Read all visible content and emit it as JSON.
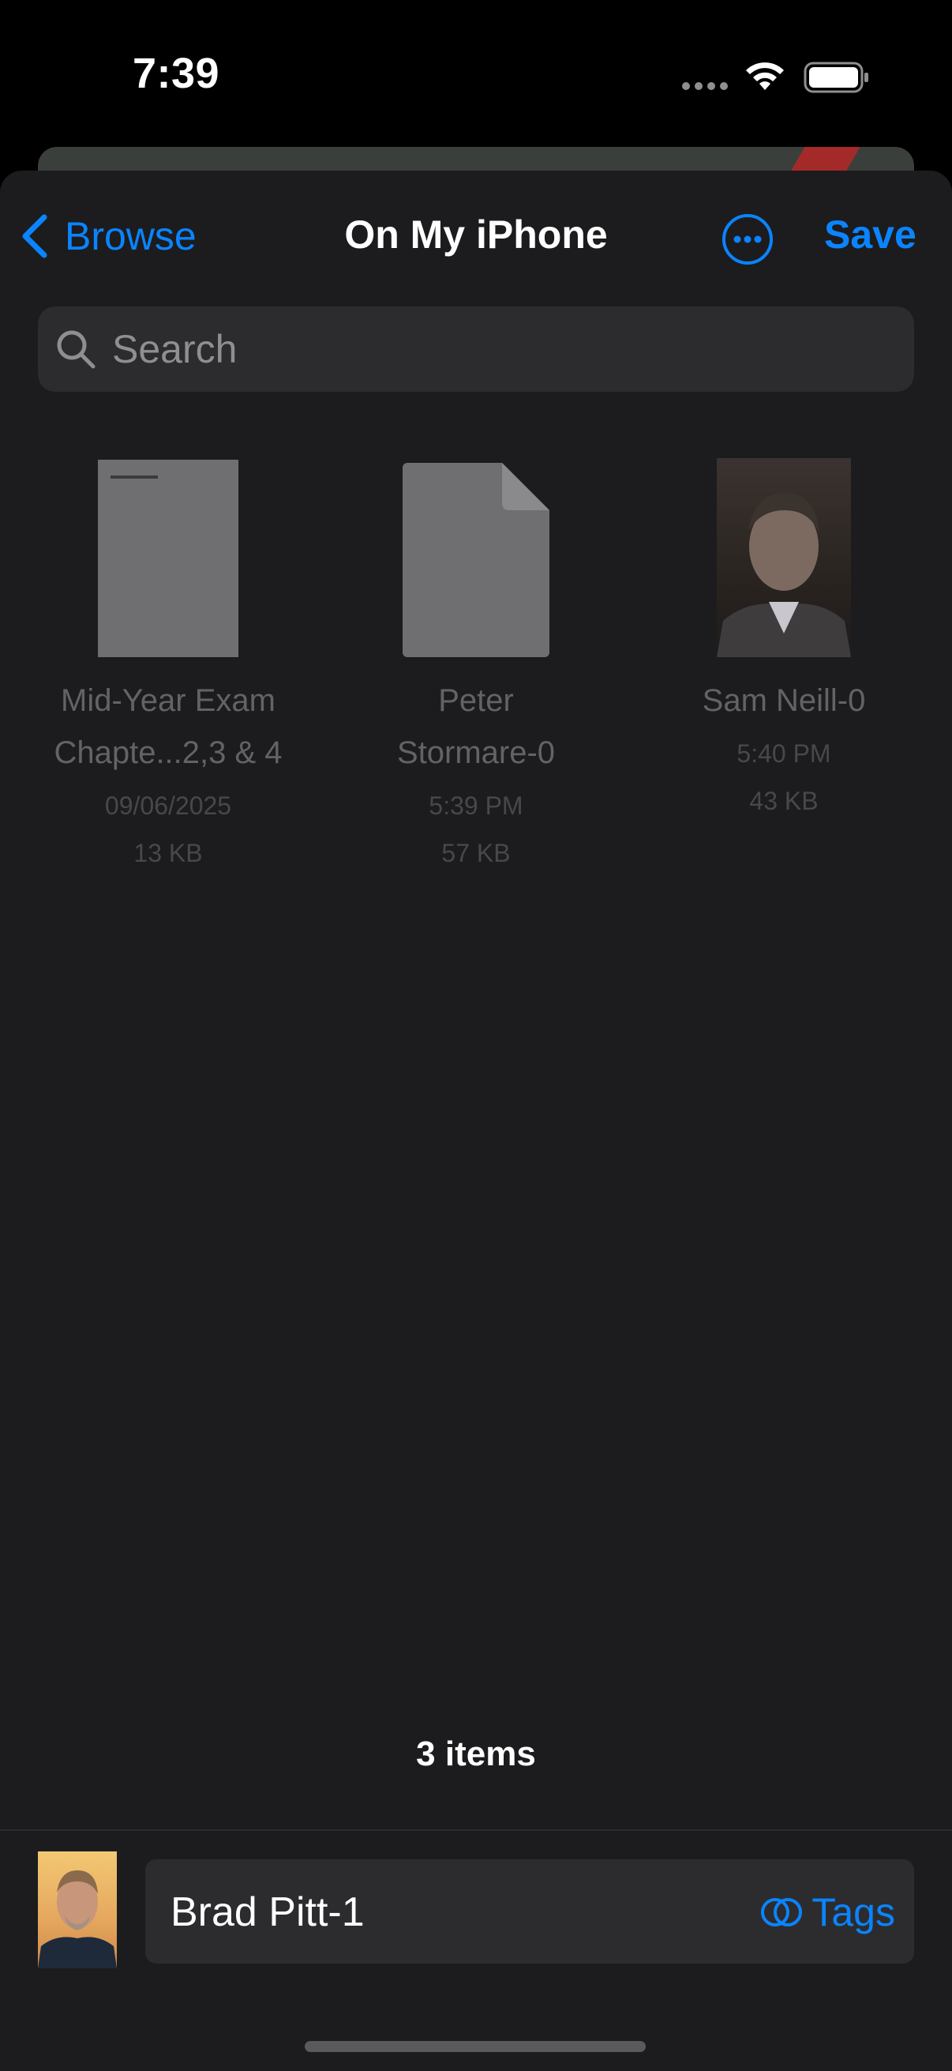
{
  "status_bar": {
    "time": "7:39"
  },
  "nav": {
    "back_label": "Browse",
    "title": "On My iPhone",
    "save_label": "Save"
  },
  "search": {
    "placeholder": "Search"
  },
  "files": [
    {
      "name_line1": "Mid-Year Exam",
      "name_line2": "Chapte...2,3 & 4",
      "date": "09/06/2025",
      "size": "13 KB",
      "thumb": "document"
    },
    {
      "name_line1": "Peter",
      "name_line2": "Stormare-0",
      "date": "5:39 PM",
      "size": "57 KB",
      "thumb": "blank-file"
    },
    {
      "name_line1": "Sam Neill-0",
      "date": "5:40 PM",
      "size": "43 KB",
      "thumb": "photo"
    }
  ],
  "item_count": "3 items",
  "save_bar": {
    "filename": "Brad Pitt-1",
    "tags_label": "Tags"
  },
  "colors": {
    "accent": "#0a84ff",
    "sheet_bg": "#1c1c1e",
    "field_bg": "#2c2c2e"
  }
}
